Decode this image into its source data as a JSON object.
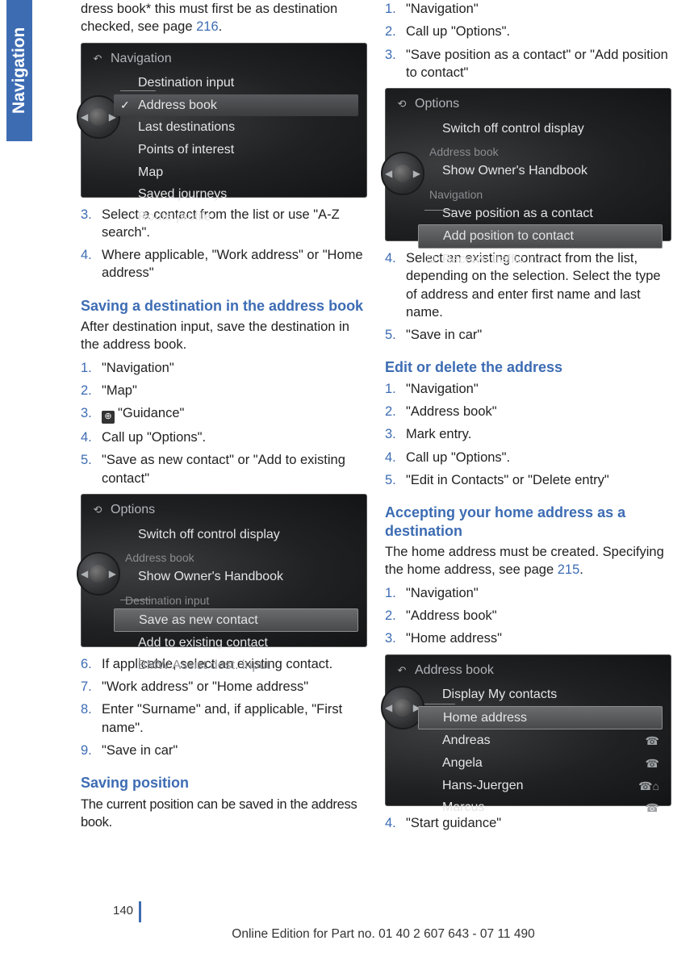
{
  "sideTab": "Navigation",
  "pageNumber": "140",
  "footer": "Online Edition for Part no. 01 40 2 607 643 - 07 11 490",
  "link216": "216",
  "link215": "215",
  "colL": {
    "introFragment": "dress book* this must first be as destination checked, see page ",
    "step3": "Select a contact from the list or use \"A-Z search\".",
    "step4": "Where applicable, \"Work address\" or \"Home address\"",
    "h_saving_dest": "Saving a destination in the address book",
    "p_saving_dest": "After destination input, save the destination in the address book.",
    "sd": {
      "s1": "\"Navigation\"",
      "s2": "\"Map\"",
      "s3": "\"Guidance\"",
      "s4": "Call up \"Options\".",
      "s5": "\"Save as new contact\" or \"Add to existing contact\"",
      "s6": "If applicable, select an existing contact.",
      "s7": "\"Work address\" or \"Home address\"",
      "s8": "Enter \"Surname\" and, if applicable, \"First name\".",
      "s9": "\"Save in car\""
    },
    "h_saving_pos": "Saving position",
    "p_saving_pos": "The current position can be saved in the address book."
  },
  "colR": {
    "sp": {
      "s1": "\"Navigation\"",
      "s2": "Call up \"Options\".",
      "s3": "\"Save position as a contact\" or \"Add position to contact\"",
      "s4": "Select an existing contract from the list, depending on the selection. Select the type of address and enter first name and last name.",
      "s5": "\"Save in car\""
    },
    "h_edit": "Edit or delete the address",
    "ed": {
      "s1": "\"Navigation\"",
      "s2": "\"Address book\"",
      "s3": "Mark entry.",
      "s4": "Call up \"Options\".",
      "s5": "\"Edit in Contacts\" or \"Delete entry\""
    },
    "h_home": "Accepting your home address as a destination",
    "p_home_a": "The home address must be created. Specifying the home address, see page ",
    "hm": {
      "s1": "\"Navigation\"",
      "s2": "\"Address book\"",
      "s3": "\"Home address\"",
      "s4": "\"Start guidance\""
    }
  },
  "fig1": {
    "title": "Navigation",
    "items": [
      "Destination input",
      "Address book",
      "Last destinations",
      "Points of interest",
      "Map",
      "Saved journeys",
      "Route profile"
    ]
  },
  "fig2": {
    "title": "Options",
    "items": [
      "Switch off control display"
    ],
    "secA": "Address book",
    "secA_items": [
      "Show Owner's Handbook"
    ],
    "secB": "Destination input",
    "secB_items": [
      "Save as new contact",
      "Add to existing contact",
      "BMW Assist dest. input"
    ]
  },
  "fig3": {
    "title": "Options",
    "items": [
      "Switch off control display"
    ],
    "secA": "Address book",
    "secA_items": [
      "Show Owner's Handbook"
    ],
    "secB": "Navigation",
    "secB_items": [
      "Save position as a contact",
      "Add position to contact",
      "Receive traffic info"
    ]
  },
  "fig4": {
    "title": "Address book",
    "items": [
      "Display My contacts",
      "Home address",
      "Andreas",
      "Angela",
      "Hans-Juergen",
      "Marcus"
    ]
  }
}
